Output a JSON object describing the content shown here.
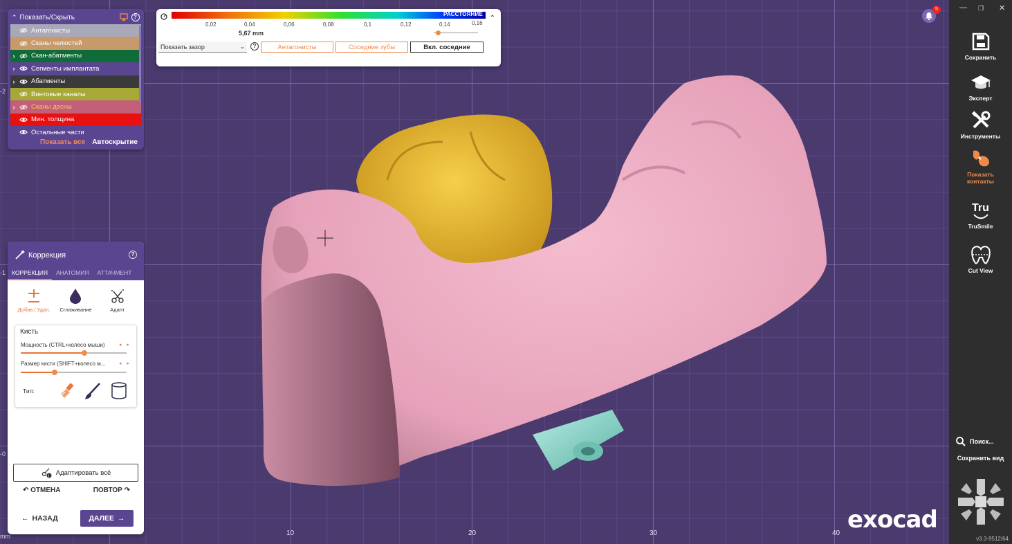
{
  "visibility_panel": {
    "title": "Показать/Скрыть",
    "rows": [
      {
        "label": "Антагонисты",
        "bg": "#a8a8b8",
        "expand": "",
        "eye": "hidden"
      },
      {
        "label": "Сканы челюстей",
        "bg": "#c79a6b",
        "expand": "",
        "eye": "hidden"
      },
      {
        "label": "Скан-абатменты",
        "bg": "#0f6b38",
        "expand": "›",
        "eye": "hidden"
      },
      {
        "label": "Сегменты имплантата",
        "bg": "#5a4690",
        "expand": "›",
        "eye": "visible"
      },
      {
        "label": "Абатменты",
        "bg": "#3a3a3a",
        "expand": "›",
        "eye": "visible"
      },
      {
        "label": "Винтовые каналы",
        "bg": "#a8a836",
        "expand": "",
        "eye": "hidden"
      },
      {
        "label": "Сканы десны",
        "bg": "#c2607a",
        "expand": "›",
        "eye": "hidden",
        "text_color": "#f7c86a"
      },
      {
        "label": "Мин. толщина",
        "bg": "#e81010",
        "expand": "",
        "eye": "visible"
      },
      {
        "label": "Остальные части",
        "bg": "#5a4690",
        "expand": "",
        "eye": "visible"
      }
    ],
    "show_all": "Показать все",
    "auto_hide": "Автоскрытие"
  },
  "distance_panel": {
    "colorbar_label": "РАССТОЯНИЕ",
    "ticks": [
      "0,02",
      "0,04",
      "0,06",
      "0,08",
      "0,1",
      "0,12",
      "0,14",
      "0,16"
    ],
    "value": "5,67 mm",
    "select_value": "Показать зазор",
    "buttons": [
      "Антагонисты",
      "Соседние зубы",
      "Вкл. соседние"
    ]
  },
  "correction_panel": {
    "title": "Коррекция",
    "tabs": [
      "КОРРЕКЦИЯ",
      "АНАТОМИЯ",
      "АТТАЧМЕНТ"
    ],
    "tools": [
      {
        "label": "Добав./ Удал.",
        "icon": "plus-minus-icon"
      },
      {
        "label": "Сглаживание",
        "icon": "drop-icon"
      },
      {
        "label": "Адапт",
        "icon": "scissors-icon"
      }
    ],
    "brush": {
      "title": "Кисть",
      "strength_label": "Мощность (CTRL+колесо мыши)",
      "strength_value": 0.6,
      "size_label": "Размер кисти (SHIFT+колесо м...",
      "size_value": 0.32,
      "type_label": "Тип:"
    },
    "adapt_all": "Адаптировать всё",
    "undo": "ОТМЕНА",
    "redo": "ПОВТОР",
    "back": "НАЗАД",
    "next": "ДАЛЕЕ"
  },
  "right_toolbar": {
    "items": [
      {
        "label": "Сохранить",
        "icon": "save-icon"
      },
      {
        "label": "Эксперт",
        "icon": "graduation-cap-icon"
      },
      {
        "label": "Инструменты",
        "icon": "tools-icon"
      },
      {
        "label": "Показать контакты",
        "icon": "contacts-icon"
      },
      {
        "label": "TruSmile",
        "icon": "trusmile-icon"
      },
      {
        "label": "Cut View",
        "icon": "cut-view-icon"
      }
    ],
    "search": "Поиск...",
    "save_view": "Сохранить вид",
    "version": "v3.3-9512/64"
  },
  "notifications": {
    "count": "5"
  },
  "axis": {
    "x_labels": [
      "10",
      "20",
      "30",
      "40"
    ],
    "y_labels": [
      "-2",
      "-1",
      "-0"
    ],
    "top_left": "mm"
  },
  "brand": "exocad",
  "colors": {
    "accent": "#f08a4b",
    "panel": "#5a4690",
    "gum": "#e9a7c0",
    "crown": "#e8b830",
    "implant": "#8fd8cc"
  }
}
